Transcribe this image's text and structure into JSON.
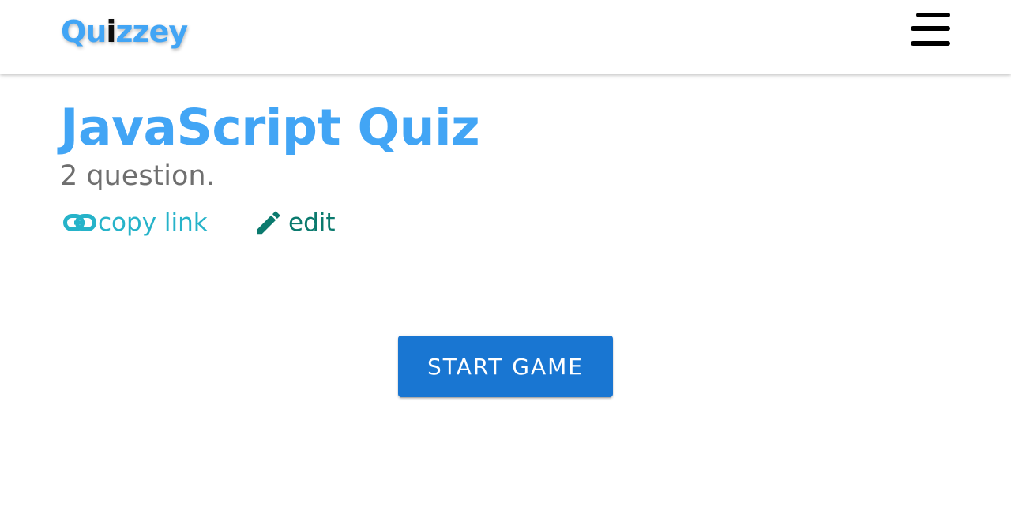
{
  "header": {
    "logo": {
      "part1": "Qu",
      "part2": "i",
      "part3": "zzey"
    },
    "menu_icon": "hamburger-menu-icon"
  },
  "quiz": {
    "title": "JavaScript Quiz",
    "subtitle": "2 question.",
    "copy_link_label": "copy link",
    "copy_link_icon": "link-icon",
    "edit_label": "edit",
    "edit_icon": "pencil-icon"
  },
  "actions": {
    "start_label": "START GAME"
  },
  "colors": {
    "brand_blue": "#42a5f5",
    "button_blue": "#1976d2",
    "copy_link": "#26b3c9",
    "edit": "#0b7a6e",
    "subtitle": "#6f6f6f"
  }
}
